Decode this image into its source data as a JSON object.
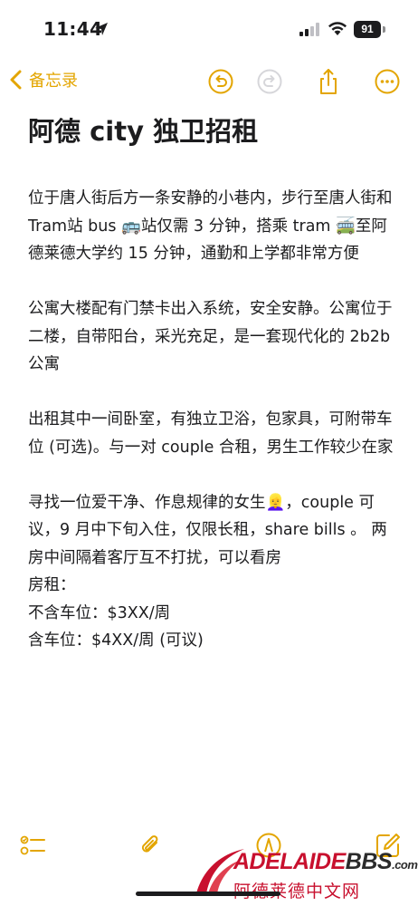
{
  "status_bar": {
    "time": "11:44",
    "battery": "91"
  },
  "nav": {
    "back_label": "备忘录"
  },
  "note": {
    "title": "阿德 city 独卫招租",
    "paragraphs": [
      "位于唐人街后方一条安静的小巷内，步行至唐人街和Tram站 bus 🚌站仅需 3 分钟，搭乘 tram 🚎至阿德莱德大学约 15 分钟，通勤和上学都非常方便",
      "",
      "公寓大楼配有门禁卡出入系统，安全安静。公寓位于二楼，自带阳台，采光充足，是一套现代化的 2b2b 公寓",
      "",
      "出租其中一间卧室，有独立卫浴，包家具，可附带车位 (可选)。与一对 couple 合租，男生工作较少在家",
      "",
      "寻找一位爱干净、作息规律的女生👱‍♀️，couple 可议，9 月中下旬入住，仅限长租，share bills 。 两房中间隔着客厅互不打扰，可以看房",
      "房租：",
      "不含车位：$3XX/周",
      "含车位：$4XX/周 (可议)"
    ]
  },
  "watermark": {
    "en_red": "ADELAIDE",
    "en_dark": "BBS",
    "en_suffix": ".com",
    "cn": "阿德莱德中文网"
  },
  "colors": {
    "accent": "#E3A500",
    "text": "#1C1C1E",
    "watermark_red": "#C8102E"
  }
}
